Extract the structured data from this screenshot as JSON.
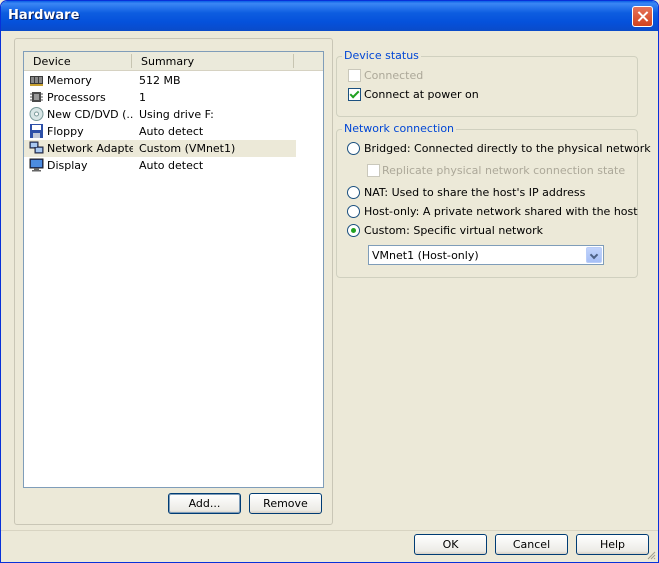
{
  "window": {
    "title": "Hardware"
  },
  "device_list": {
    "columns": [
      "Device",
      "Summary"
    ],
    "rows": [
      {
        "device": "Memory",
        "summary": "512 MB",
        "icon": "memory-icon"
      },
      {
        "device": "Processors",
        "summary": "1",
        "icon": "processor-icon"
      },
      {
        "device": "New CD/DVD (...",
        "summary": "Using drive F:",
        "icon": "cd-dvd-icon"
      },
      {
        "device": "Floppy",
        "summary": "Auto detect",
        "icon": "floppy-icon"
      },
      {
        "device": "Network Adapter",
        "summary": "Custom (VMnet1)",
        "icon": "network-adapter-icon",
        "selected": true
      },
      {
        "device": "Display",
        "summary": "Auto detect",
        "icon": "display-icon"
      }
    ]
  },
  "buttons": {
    "add": "Add...",
    "remove": "Remove",
    "ok": "OK",
    "cancel": "Cancel",
    "help": "Help"
  },
  "device_status": {
    "title": "Device status",
    "connected": "Connected",
    "connect_at_power_on": "Connect at power on"
  },
  "network_connection": {
    "title": "Network connection",
    "bridged": "Bridged: Connected directly to the physical network",
    "replicate": "Replicate physical network connection state",
    "nat": "NAT: Used to share the host's IP address",
    "host_only": "Host-only: A private network shared with the host",
    "custom": "Custom: Specific virtual network",
    "selected_network": "VMnet1 (Host-only)"
  },
  "colors": {
    "title_bar": "#0A5FE6",
    "group_title": "#0046D5",
    "check_mark": "#21A121"
  }
}
